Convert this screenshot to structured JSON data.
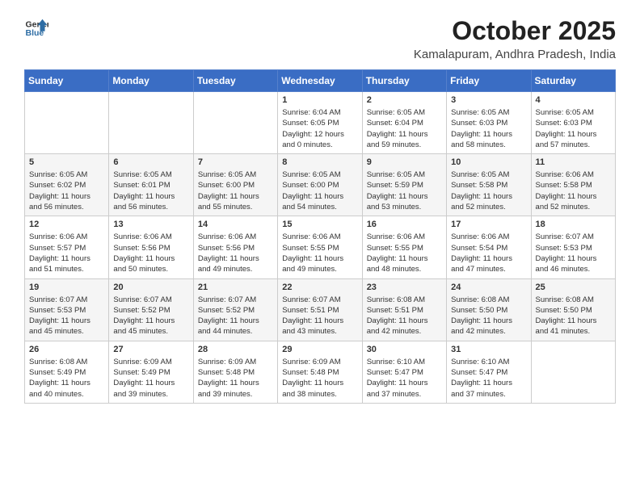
{
  "logo": {
    "line1": "General",
    "line2": "Blue"
  },
  "title": "October 2025",
  "subtitle": "Kamalapuram, Andhra Pradesh, India",
  "days_of_week": [
    "Sunday",
    "Monday",
    "Tuesday",
    "Wednesday",
    "Thursday",
    "Friday",
    "Saturday"
  ],
  "weeks": [
    [
      {
        "day": "",
        "info": ""
      },
      {
        "day": "",
        "info": ""
      },
      {
        "day": "",
        "info": ""
      },
      {
        "day": "1",
        "info": "Sunrise: 6:04 AM\nSunset: 6:05 PM\nDaylight: 12 hours\nand 0 minutes."
      },
      {
        "day": "2",
        "info": "Sunrise: 6:05 AM\nSunset: 6:04 PM\nDaylight: 11 hours\nand 59 minutes."
      },
      {
        "day": "3",
        "info": "Sunrise: 6:05 AM\nSunset: 6:03 PM\nDaylight: 11 hours\nand 58 minutes."
      },
      {
        "day": "4",
        "info": "Sunrise: 6:05 AM\nSunset: 6:03 PM\nDaylight: 11 hours\nand 57 minutes."
      }
    ],
    [
      {
        "day": "5",
        "info": "Sunrise: 6:05 AM\nSunset: 6:02 PM\nDaylight: 11 hours\nand 56 minutes."
      },
      {
        "day": "6",
        "info": "Sunrise: 6:05 AM\nSunset: 6:01 PM\nDaylight: 11 hours\nand 56 minutes."
      },
      {
        "day": "7",
        "info": "Sunrise: 6:05 AM\nSunset: 6:00 PM\nDaylight: 11 hours\nand 55 minutes."
      },
      {
        "day": "8",
        "info": "Sunrise: 6:05 AM\nSunset: 6:00 PM\nDaylight: 11 hours\nand 54 minutes."
      },
      {
        "day": "9",
        "info": "Sunrise: 6:05 AM\nSunset: 5:59 PM\nDaylight: 11 hours\nand 53 minutes."
      },
      {
        "day": "10",
        "info": "Sunrise: 6:05 AM\nSunset: 5:58 PM\nDaylight: 11 hours\nand 52 minutes."
      },
      {
        "day": "11",
        "info": "Sunrise: 6:06 AM\nSunset: 5:58 PM\nDaylight: 11 hours\nand 52 minutes."
      }
    ],
    [
      {
        "day": "12",
        "info": "Sunrise: 6:06 AM\nSunset: 5:57 PM\nDaylight: 11 hours\nand 51 minutes."
      },
      {
        "day": "13",
        "info": "Sunrise: 6:06 AM\nSunset: 5:56 PM\nDaylight: 11 hours\nand 50 minutes."
      },
      {
        "day": "14",
        "info": "Sunrise: 6:06 AM\nSunset: 5:56 PM\nDaylight: 11 hours\nand 49 minutes."
      },
      {
        "day": "15",
        "info": "Sunrise: 6:06 AM\nSunset: 5:55 PM\nDaylight: 11 hours\nand 49 minutes."
      },
      {
        "day": "16",
        "info": "Sunrise: 6:06 AM\nSunset: 5:55 PM\nDaylight: 11 hours\nand 48 minutes."
      },
      {
        "day": "17",
        "info": "Sunrise: 6:06 AM\nSunset: 5:54 PM\nDaylight: 11 hours\nand 47 minutes."
      },
      {
        "day": "18",
        "info": "Sunrise: 6:07 AM\nSunset: 5:53 PM\nDaylight: 11 hours\nand 46 minutes."
      }
    ],
    [
      {
        "day": "19",
        "info": "Sunrise: 6:07 AM\nSunset: 5:53 PM\nDaylight: 11 hours\nand 45 minutes."
      },
      {
        "day": "20",
        "info": "Sunrise: 6:07 AM\nSunset: 5:52 PM\nDaylight: 11 hours\nand 45 minutes."
      },
      {
        "day": "21",
        "info": "Sunrise: 6:07 AM\nSunset: 5:52 PM\nDaylight: 11 hours\nand 44 minutes."
      },
      {
        "day": "22",
        "info": "Sunrise: 6:07 AM\nSunset: 5:51 PM\nDaylight: 11 hours\nand 43 minutes."
      },
      {
        "day": "23",
        "info": "Sunrise: 6:08 AM\nSunset: 5:51 PM\nDaylight: 11 hours\nand 42 minutes."
      },
      {
        "day": "24",
        "info": "Sunrise: 6:08 AM\nSunset: 5:50 PM\nDaylight: 11 hours\nand 42 minutes."
      },
      {
        "day": "25",
        "info": "Sunrise: 6:08 AM\nSunset: 5:50 PM\nDaylight: 11 hours\nand 41 minutes."
      }
    ],
    [
      {
        "day": "26",
        "info": "Sunrise: 6:08 AM\nSunset: 5:49 PM\nDaylight: 11 hours\nand 40 minutes."
      },
      {
        "day": "27",
        "info": "Sunrise: 6:09 AM\nSunset: 5:49 PM\nDaylight: 11 hours\nand 39 minutes."
      },
      {
        "day": "28",
        "info": "Sunrise: 6:09 AM\nSunset: 5:48 PM\nDaylight: 11 hours\nand 39 minutes."
      },
      {
        "day": "29",
        "info": "Sunrise: 6:09 AM\nSunset: 5:48 PM\nDaylight: 11 hours\nand 38 minutes."
      },
      {
        "day": "30",
        "info": "Sunrise: 6:10 AM\nSunset: 5:47 PM\nDaylight: 11 hours\nand 37 minutes."
      },
      {
        "day": "31",
        "info": "Sunrise: 6:10 AM\nSunset: 5:47 PM\nDaylight: 11 hours\nand 37 minutes."
      },
      {
        "day": "",
        "info": ""
      }
    ]
  ]
}
